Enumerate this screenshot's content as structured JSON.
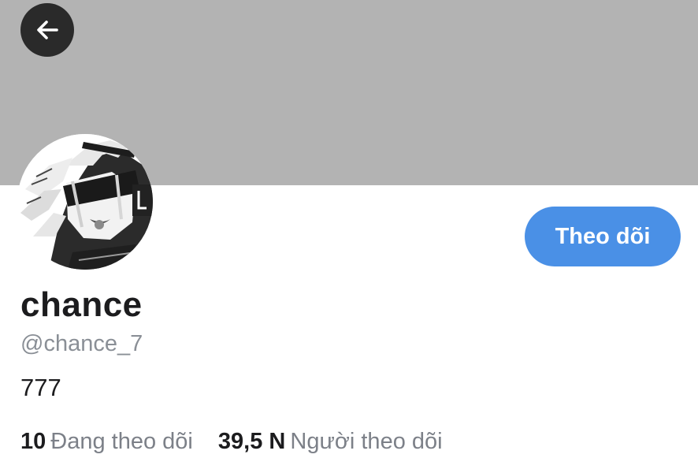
{
  "profile": {
    "display_name": "chance",
    "handle": "@chance_7",
    "bio": "777",
    "follow_label": "Theo dõi"
  },
  "stats": {
    "following_count": "10",
    "following_label": "Đang theo dõi",
    "followers_count": "39,5 N",
    "followers_label": "Người theo dõi"
  },
  "icons": {
    "back": "arrow-left-icon"
  },
  "colors": {
    "banner": "#b3b3b3",
    "accent": "#4a90e6",
    "back_button_bg": "#2a2a2a",
    "secondary_text": "#8a8f96"
  }
}
